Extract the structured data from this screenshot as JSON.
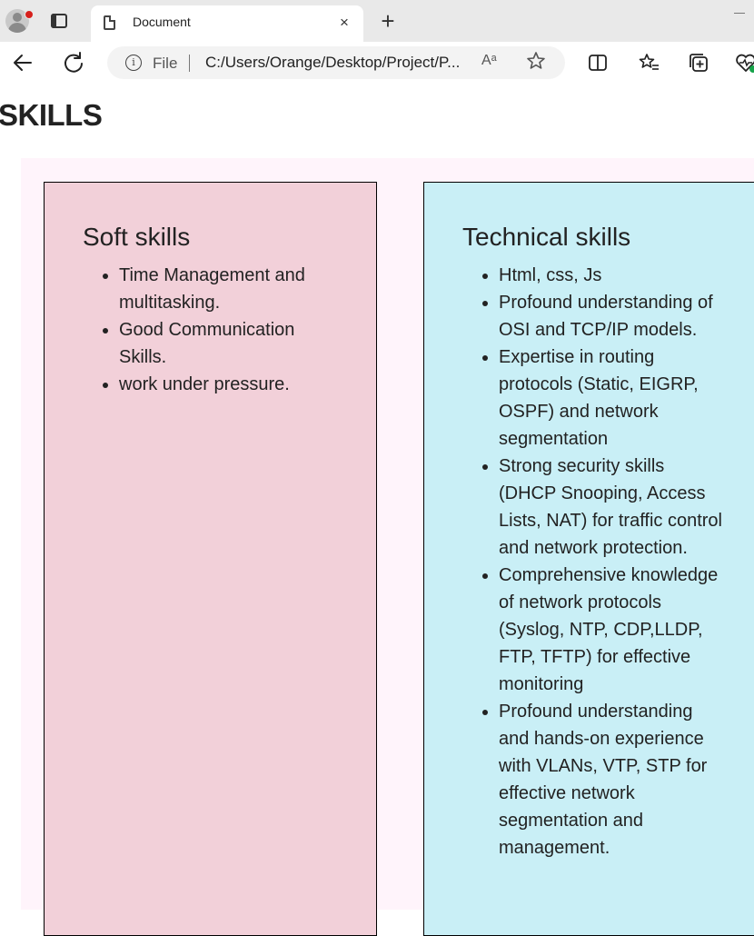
{
  "browser": {
    "tab_title": "Document",
    "tab_close_glyph": "×",
    "new_tab_glyph": "+",
    "address_scheme": "File",
    "address_url": "C:/Users/Orange/Desktop/Project/P...",
    "read_aloud_glyph": "Aᵃ",
    "icons": [
      "profile-icon",
      "tab-actions-icon",
      "document-icon",
      "close-icon",
      "new-tab-icon",
      "back-icon",
      "refresh-icon",
      "info-icon",
      "read-aloud-icon",
      "favorite-star-icon",
      "split-screen-icon",
      "favorites-icon",
      "collections-icon",
      "browser-essentials-icon"
    ]
  },
  "page": {
    "title": "SKILLS",
    "soft": {
      "heading": "Soft skills",
      "items": [
        "Time Management and multitasking.",
        "Good Communication Skills.",
        "work under pressure."
      ]
    },
    "technical": {
      "heading": "Technical skills",
      "items": [
        "Html, css, Js",
        "Profound understanding of OSI and TCP/IP models.",
        "Expertise in routing protocols (Static, EIGRP, OSPF) and network segmentation",
        "Strong security skills (DHCP Snooping, Access Lists, NAT) for traffic control and network protection.",
        "Comprehensive knowledge of network protocols (Syslog, NTP, CDP,LLDP, FTP, TFTP) for effective monitoring",
        "Profound understanding and hands-on experience with VLANs, VTP, STP for effective network segmentation and management."
      ]
    }
  },
  "colors": {
    "section_bg": "#fff4fb",
    "soft_card_bg": "#f2d0d9",
    "tech_card_bg": "#c9eff6",
    "text": "#222222"
  }
}
